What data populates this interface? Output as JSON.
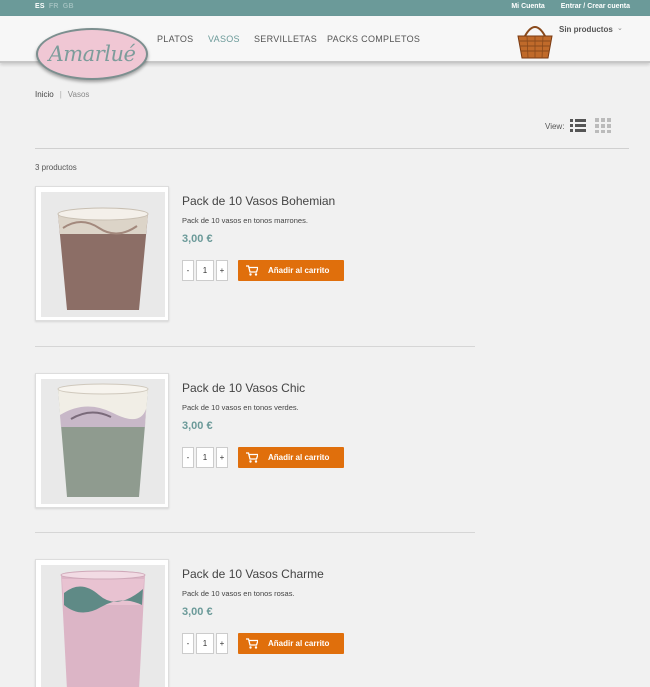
{
  "topbar": {
    "languages": [
      {
        "code": "ES",
        "active": true
      },
      {
        "code": "FR",
        "active": false
      },
      {
        "code": "GB",
        "active": false
      }
    ],
    "my_account": "Mi Cuenta",
    "login": "Entrar / Crear cuenta"
  },
  "header": {
    "logo_text": "Amarlué",
    "nav": [
      "PLATOS",
      "VASOS",
      "SERVILLETAS",
      "PACKS COMPLETOS"
    ],
    "nav_active": "VASOS",
    "cart_label": "Sin productos",
    "cart_caret": "⌄"
  },
  "breadcrumb": {
    "home": "Inicio",
    "separator": "|",
    "current": "Vasos"
  },
  "view": {
    "label": "View:",
    "icons": [
      "list-view-icon",
      "grid-view-icon"
    ]
  },
  "listing": {
    "count": "3 productos"
  },
  "products": [
    {
      "name": "Pack de 10 Vasos Bohemian",
      "description": "Pack de 10 vasos en tonos marrones.",
      "price": "3,00 €",
      "qty": "1",
      "minus": "-",
      "plus": "+",
      "add": "Añadir al carrito",
      "cup_body_color": "#8c6e66",
      "cup_band_color": "#dcd4c8"
    },
    {
      "name": "Pack de 10 Vasos Chic",
      "description": "Pack de 10 vasos en tonos verdes.",
      "price": "3,00 €",
      "qty": "1",
      "minus": "-",
      "plus": "+",
      "add": "Añadir al carrito",
      "cup_body_color": "#8f9b8f",
      "cup_band_color": "#c8b8c8"
    },
    {
      "name": "Pack de 10 Vasos Charme",
      "description": "Pack de 10 vasos en tonos rosas.",
      "price": "3,00 €",
      "qty": "1",
      "minus": "-",
      "plus": "+",
      "add": "Añadir al carrito",
      "cup_body_color": "#dcb5c6",
      "cup_band_color": "#5f8a86"
    }
  ],
  "colors": {
    "accent": "#6b9a99",
    "button": "#e06f0c",
    "logo_pink": "#f0c7d4"
  }
}
